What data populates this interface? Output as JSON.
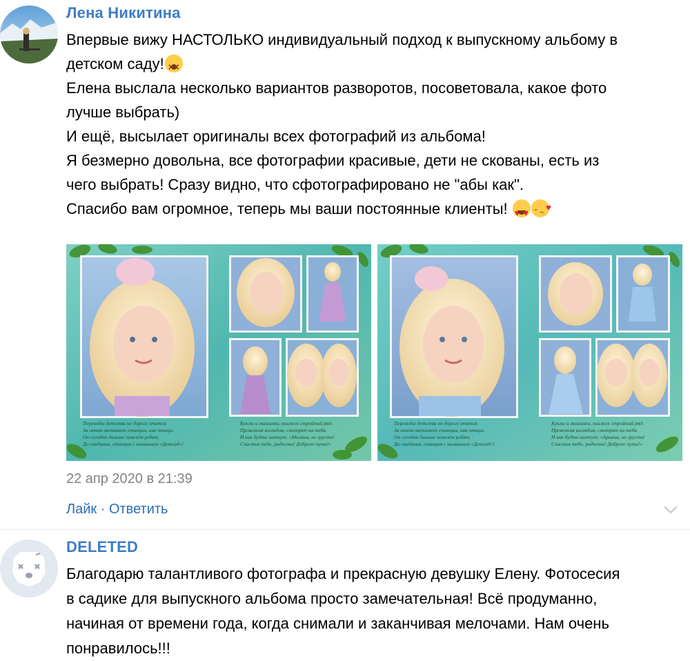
{
  "comments": [
    {
      "author": "Лена Никитина",
      "lines": [
        "Впервые вижу НАСТОЛЬКО индивидуальный подход к выпускному альбому в",
        "детском саду!",
        "Елена выслала несколько вариантов разворотов, посоветовала, какое фото",
        "лучше выбрать)",
        "И ещё, высылает оригиналы всех фотографий из альбома!",
        "Я безмерно довольна, все фотографии красивые, дети не скованы, есть из",
        "чего выбрать! Сразу видно, что сфотографировано не \"абы как\".",
        "Спасибо вам огромное, теперь мы ваши постоянные клиенты! "
      ],
      "emoji": [
        "dizzy-face-icon",
        "heart-eyes-icon",
        "kiss-face-icon"
      ],
      "date": "22 апр 2020 в 21:39",
      "like": "Лайк",
      "separator": " · ",
      "reply": "Ответить",
      "photo_poems": {
        "left": [
          "Переводы детства по дороге мчится.",
          "За окном мелькают станции, как птицы.",
          "Он сегодня дальше повезёт ребят.",
          "До свиданья, станция с названием «Детсад»!"
        ],
        "right": [
          "Куклы и машинки, книжек стройный ряд.",
          "Провожая взглядом, смотрят на тебя.",
          "И как будто шепчут: «Милана, не грусти!",
          "Счастья тебе, радости! Доброго пути!»"
        ],
        "right2": [
          "Куклы и машинки, книжек стройный ряд.",
          "Провожая взглядом, смотрят на тебя.",
          "И как будто шепчут: «Ариана, не грусти!",
          "Счастья тебе, радости! Доброго пути!»"
        ]
      }
    },
    {
      "author": "DELETED",
      "lines": [
        "Благодарю талантливого фотографа и прекрасную девушку Елену. Фотосесия",
        "в садике для выпускного альбома просто замечательная! Всё продуманно,",
        "начиная от времени года, когда снимали и заканчивая мелочами. Нам очень",
        "понравилось!!!"
      ]
    }
  ],
  "colors": {
    "author": "#3d7cc6",
    "link": "#2a6db7",
    "date": "#828282",
    "divider": "#e7e8ec"
  }
}
